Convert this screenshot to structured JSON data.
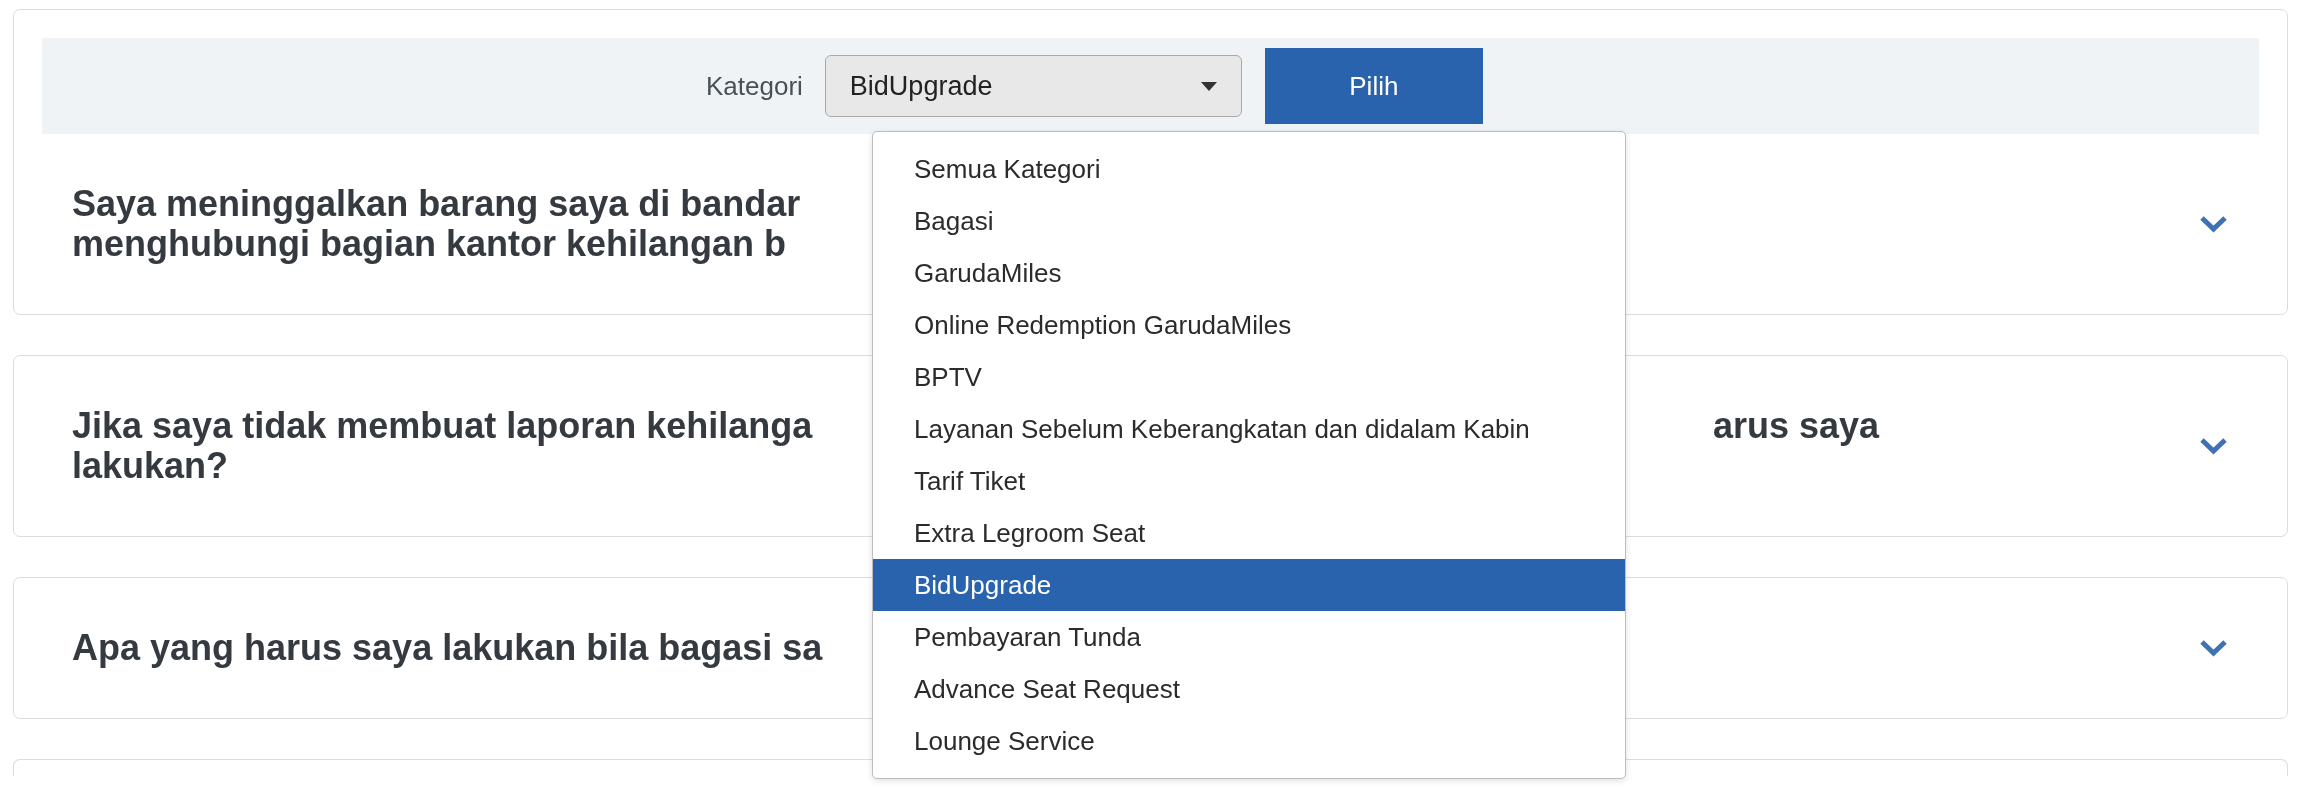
{
  "filter": {
    "label": "Kategori",
    "select": {
      "value": "BidUpgrade",
      "open": true
    },
    "button": "Pilih"
  },
  "dropdown": {
    "options": [
      {
        "label": "Semua Kategori",
        "selected": false
      },
      {
        "label": "Bagasi",
        "selected": false
      },
      {
        "label": "GarudaMiles",
        "selected": false
      },
      {
        "label": "Online Redemption GarudaMiles",
        "selected": false
      },
      {
        "label": "BPTV",
        "selected": false
      },
      {
        "label": "Layanan Sebelum Keberangkatan dan didalam Kabin",
        "selected": false
      },
      {
        "label": "Tarif Tiket",
        "selected": false
      },
      {
        "label": "Extra Legroom Seat",
        "selected": false
      },
      {
        "label": "BidUpgrade",
        "selected": true
      },
      {
        "label": "Pembayaran Tunda",
        "selected": false
      },
      {
        "label": "Advance Seat Request",
        "selected": false
      },
      {
        "label": "Lounge Service",
        "selected": false
      }
    ]
  },
  "faqs": [
    {
      "kind": "question",
      "expanded": false,
      "lines": [
        {
          "text": "Saya meninggalkan barang saya di bandar"
        },
        {
          "text": "menghubungi bagian kantor kehilangan b"
        }
      ]
    },
    {
      "kind": "question",
      "expanded": false,
      "lines": [
        {
          "text": "Jika saya tidak membuat laporan kehilanga",
          "tail": "arus saya"
        },
        {
          "text": "lakukan?"
        }
      ]
    },
    {
      "kind": "question",
      "expanded": false,
      "lines": [
        {
          "text": "Apa yang harus saya lakukan bila bagasi sa"
        }
      ]
    },
    {
      "kind": "partial"
    }
  ]
}
